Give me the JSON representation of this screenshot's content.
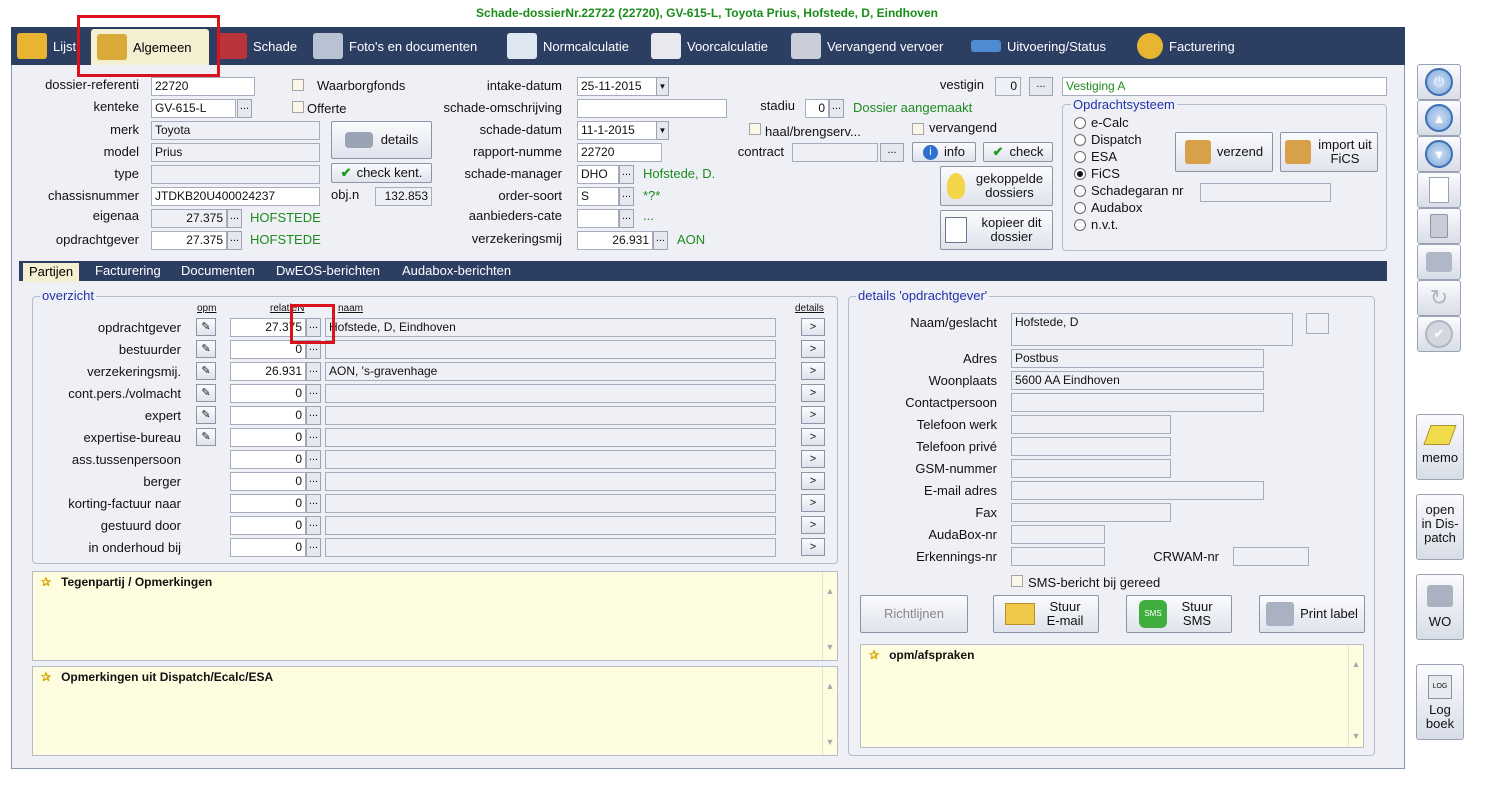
{
  "title": "Schade-dossierNr.22722 (22720), GV-615-L, Toyota Prius, Hofstede, D, Eindhoven",
  "tabs": [
    "Lijst",
    "Algemeen",
    "Schade",
    "Foto's en documenten",
    "Normcalculatie",
    "Voorcalculatie",
    "Vervangend vervoer",
    "Uitvoering/Status",
    "Facturering"
  ],
  "col1": {
    "dossier_label": "dossier-referenti",
    "dossier_value": "22720",
    "kenteken_label": "kenteke",
    "kenteken_value": "GV-615-L",
    "merk_label": "merk",
    "merk_value": "Toyota",
    "model_label": "model",
    "model_value": "Prius",
    "type_label": "type",
    "type_value": "",
    "chassis_label": "chassisnummer",
    "chassis_value": "JTDKB20U400024237",
    "eigenaar_label": "eigenaa",
    "eigenaar_value": "27.375",
    "eigenaar_name": "HOFSTEDE",
    "opdrachtgever_label": "opdrachtgever",
    "opdrachtgever_value": "27.375",
    "opdrachtgever_name": "HOFSTEDE",
    "waarborgfonds": "Waarborgfonds",
    "offerte": "Offerte",
    "details": "details",
    "check_kent": "check kent.",
    "objn_label": "obj.n",
    "objn_value": "132.853"
  },
  "col2": {
    "intake_label": "intake-datum",
    "intake_value": "25-11-2015",
    "omschrijving_label": "schade-omschrijving",
    "omschrijving_value": "",
    "schadedatum_label": "schade-datum",
    "schadedatum_value": "11-1-2015",
    "rapport_label": "rapport-numme",
    "rapport_value": "22720",
    "manager_label": "schade-manager",
    "manager_value": "DHO",
    "manager_name": "Hofstede, D.",
    "order_label": "order-soort",
    "order_value": "S",
    "order_extra": "*?*",
    "aanbieder_label": "aanbieders-cate",
    "aanbieder_value": "",
    "aanbieder_extra": "...",
    "verzekering_label": "verzekeringsmij",
    "verzekering_value": "26.931",
    "verzekering_name": "AON"
  },
  "col3": {
    "stadium_label": "stadiu",
    "stadium_value": "0",
    "stadium_text": "Dossier aangemaakt",
    "haal": "haal/brengserv...",
    "vervangend": "vervangend",
    "contract_label": "contract",
    "info": "info",
    "check": "check",
    "gekoppelde": "gekoppelde dossiers",
    "kopieer": "kopieer dit dossier"
  },
  "col4": {
    "vestiging_label": "vestigin",
    "vestiging_value": "0",
    "vestiging_name": "Vestiging A",
    "opdrachtsysteem": "Opdrachtsysteem",
    "radios": [
      "e-Calc",
      "Dispatch",
      "ESA",
      "FiCS",
      "Schadegaran nr",
      "Audabox",
      "n.v.t."
    ],
    "selected_radio": "FiCS",
    "verzend": "verzend",
    "import": "import uit FiCS"
  },
  "subtabs": [
    "Partijen",
    "Facturering",
    "Documenten",
    "DwEOS-berichten",
    "Audabox-berichten"
  ],
  "overzicht": {
    "title": "overzicht",
    "hdr_opm": "opm",
    "hdr_relatie": "relatieN",
    "hdr_naam": "naam",
    "hdr_details": "details",
    "rows": [
      {
        "label": "opdrachtgever",
        "pin": true,
        "num": "27.375",
        "name": "Hofstede, D, Eindhoven"
      },
      {
        "label": "bestuurder",
        "pin": true,
        "num": "0",
        "name": ""
      },
      {
        "label": "verzekeringsmij.",
        "pin": true,
        "num": "26.931",
        "name": "AON, 's-gravenhage"
      },
      {
        "label": "cont.pers./volmacht",
        "pin": true,
        "num": "0",
        "name": ""
      },
      {
        "label": "expert",
        "pin": true,
        "num": "0",
        "name": ""
      },
      {
        "label": "expertise-bureau",
        "pin": true,
        "num": "0",
        "name": ""
      },
      {
        "label": "ass.tussenpersoon",
        "pin": false,
        "num": "0",
        "name": ""
      },
      {
        "label": "berger",
        "pin": false,
        "num": "0",
        "name": ""
      },
      {
        "label": "korting-factuur naar",
        "pin": false,
        "num": "0",
        "name": ""
      },
      {
        "label": "gestuurd door",
        "pin": false,
        "num": "0",
        "name": ""
      },
      {
        "label": "in onderhoud bij",
        "pin": false,
        "num": "0",
        "name": ""
      }
    ]
  },
  "notes": {
    "tegenpartij": "Tegenpartij / Opmerkingen",
    "dispatch": "Opmerkingen uit Dispatch/Ecalc/ESA",
    "afspraken": "opm/afspraken"
  },
  "details": {
    "title": "details 'opdrachtgever'",
    "naam_label": "Naam/geslacht",
    "naam_value": "Hofstede, D",
    "adres_label": "Adres",
    "adres_value": "Postbus",
    "woonplaats_label": "Woonplaats",
    "woonplaats_value": "5600 AA  Eindhoven",
    "contact_label": "Contactpersoon",
    "telwerk_label": "Telefoon werk",
    "telprive_label": "Telefoon privé",
    "gsm_label": "GSM-nummer",
    "email_label": "E-mail adres",
    "fax_label": "Fax",
    "audabox_label": "AudaBox-nr",
    "erkennings_label": "Erkennings-nr",
    "crwam_label": "CRWAM-nr",
    "sms_check": "SMS-bericht bij gereed",
    "richtlijnen": "Richtlijnen",
    "stuur_email": "Stuur E-mail",
    "stuur_sms": "Stuur SMS",
    "print_label": "Print label"
  },
  "side": {
    "memo": "memo",
    "open": "open in Dis- patch",
    "wo": "WO",
    "log": "Log boek"
  }
}
